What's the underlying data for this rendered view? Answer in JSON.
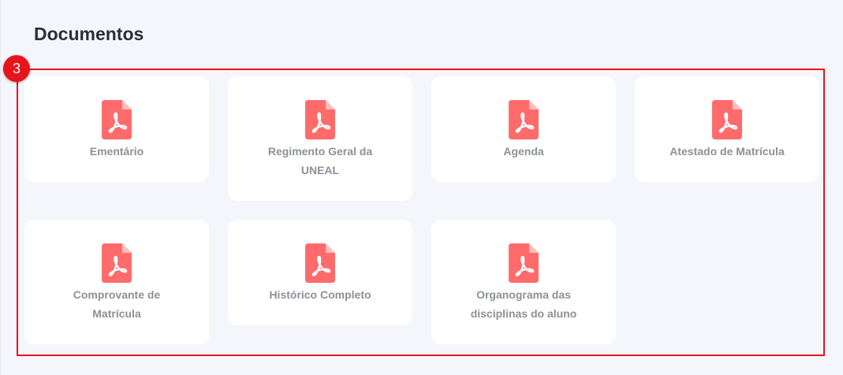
{
  "page": {
    "title": "Documentos",
    "step_badge": "3"
  },
  "colors": {
    "highlight": "#e8141b",
    "pdf_icon": "#ff6b6b",
    "label": "#8e9099",
    "background": "#f5f6fb"
  },
  "documents": [
    {
      "label": "Ementário",
      "icon": "pdf-file-icon"
    },
    {
      "label": "Regimento Geral da UNEAL",
      "icon": "pdf-file-icon"
    },
    {
      "label": "Agenda",
      "icon": "pdf-file-icon"
    },
    {
      "label": "Atestado de Matrícula",
      "icon": "pdf-file-icon"
    },
    {
      "label": "Comprovante de Matrícula",
      "icon": "pdf-file-icon"
    },
    {
      "label": "Histórico Completo",
      "icon": "pdf-file-icon"
    },
    {
      "label": "Organograma das disciplinas do aluno",
      "icon": "pdf-file-icon"
    }
  ]
}
